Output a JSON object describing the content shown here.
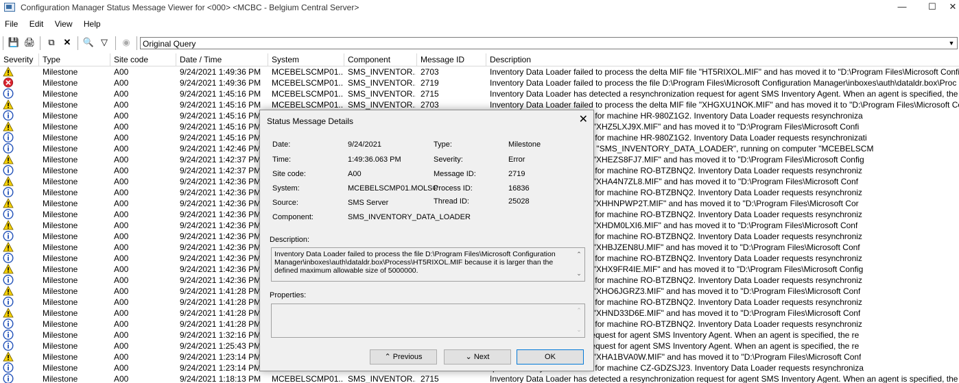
{
  "window": {
    "title": "Configuration Manager Status Message Viewer for <000> <MCBC - Belgium Central Server>"
  },
  "menu": [
    "File",
    "Edit",
    "View",
    "Help"
  ],
  "toolbar": {
    "query": "Original Query"
  },
  "columns": [
    "Severity",
    "Type",
    "Site code",
    "Date / Time",
    "System",
    "Component",
    "Message ID",
    "Description"
  ],
  "rows": [
    {
      "sev": "warning",
      "type": "Milestone",
      "site": "A00",
      "time": "9/24/2021 1:49:36 PM",
      "system": "MCEBELSCMP01...",
      "component": "SMS_INVENTOR...",
      "id": "2703",
      "desc": "Inventory Data Loader failed to process the delta MIF file \"HT5RIXOL.MIF\" and has moved it to \"D:\\Program Files\\Microsoft Configu"
    },
    {
      "sev": "error",
      "type": "Milestone",
      "site": "A00",
      "time": "9/24/2021 1:49:36 PM",
      "system": "MCEBELSCMP01...",
      "component": "SMS_INVENTOR...",
      "id": "2719",
      "desc": "Inventory Data Loader failed to process the file D:\\Program Files\\Microsoft Configuration Manager\\inboxes\\auth\\dataldr.box\\Proc"
    },
    {
      "sev": "info",
      "type": "Milestone",
      "site": "A00",
      "time": "9/24/2021 1:45:16 PM",
      "system": "MCEBELSCMP01...",
      "component": "SMS_INVENTOR...",
      "id": "2715",
      "desc": "Inventory Data Loader has detected a resynchronization request for agent SMS Inventory Agent. When an agent is specified, the re"
    },
    {
      "sev": "warning",
      "type": "Milestone",
      "site": "A00",
      "time": "9/24/2021 1:45:16 PM",
      "system": "MCEBELSCMP01...",
      "component": "SMS_INVENTOR...",
      "id": "2703",
      "desc": "Inventory Data Loader failed to process the delta MIF file \"XHGXU1NOK.MIF\" and has moved it to \"D:\\Program Files\\Microsoft Con"
    },
    {
      "sev": "info",
      "type": "Milestone",
      "site": "A00",
      "time": "9/24/2021 1:45:16 PM",
      "system": "",
      "component": "",
      "id": "",
      "desc": "quested a resynchronization for machine HR-980Z1G2. Inventory Data Loader requests resynchroniza"
    },
    {
      "sev": "warning",
      "type": "Milestone",
      "site": "A00",
      "time": "9/24/2021 1:45:16 PM",
      "system": "",
      "component": "",
      "id": "",
      "desc": "to process the delta MIF file \"XHZ5LXJ9X.MIF\" and has moved it to \"D:\\Program Files\\Microsoft Confi"
    },
    {
      "sev": "info",
      "type": "Milestone",
      "site": "A00",
      "time": "9/24/2021 1:45:16 PM",
      "system": "",
      "component": "",
      "id": "",
      "desc": "quested a resynchronization for machine HR-980Z1G2. Inventory Data Loader requests resynchronizati"
    },
    {
      "sev": "info",
      "type": "Milestone",
      "site": "A00",
      "time": "9/24/2021 1:42:46 PM",
      "system": "",
      "component": "",
      "id": "",
      "desc": "zer detected that component \"SMS_INVENTORY_DATA_LOADER\", running on computer \"MCEBELSCM"
    },
    {
      "sev": "warning",
      "type": "Milestone",
      "site": "A00",
      "time": "9/24/2021 1:42:37 PM",
      "system": "",
      "component": "",
      "id": "",
      "desc": "to process the delta MIF file \"XHEZS8FJ7.MIF\" and has moved it to \"D:\\Program Files\\Microsoft Config"
    },
    {
      "sev": "info",
      "type": "Milestone",
      "site": "A00",
      "time": "9/24/2021 1:42:37 PM",
      "system": "",
      "component": "",
      "id": "",
      "desc": "quested a resynchronization for machine RO-BTZBNQ2. Inventory Data Loader requests resynchroniz"
    },
    {
      "sev": "warning",
      "type": "Milestone",
      "site": "A00",
      "time": "9/24/2021 1:42:36 PM",
      "system": "",
      "component": "",
      "id": "",
      "desc": "to process the delta MIF file \"XHA4N7ZL8.MIF\" and has moved it to \"D:\\Program Files\\Microsoft Conf"
    },
    {
      "sev": "info",
      "type": "Milestone",
      "site": "A00",
      "time": "9/24/2021 1:42:36 PM",
      "system": "",
      "component": "",
      "id": "",
      "desc": "quested a resynchronization for machine RO-BTZBNQ2. Inventory Data Loader requests resynchroniz"
    },
    {
      "sev": "warning",
      "type": "Milestone",
      "site": "A00",
      "time": "9/24/2021 1:42:36 PM",
      "system": "",
      "component": "",
      "id": "",
      "desc": "to process the delta MIF file \"XHHNPWP2T.MIF\" and has moved it to \"D:\\Program Files\\Microsoft Cor"
    },
    {
      "sev": "info",
      "type": "Milestone",
      "site": "A00",
      "time": "9/24/2021 1:42:36 PM",
      "system": "",
      "component": "",
      "id": "",
      "desc": "quested a resynchronization for machine RO-BTZBNQ2. Inventory Data Loader requests resynchroniz"
    },
    {
      "sev": "warning",
      "type": "Milestone",
      "site": "A00",
      "time": "9/24/2021 1:42:36 PM",
      "system": "",
      "component": "",
      "id": "",
      "desc": "to process the delta MIF file \"XHDM0LXI6.MIF\" and has moved it to \"D:\\Program Files\\Microsoft Conf"
    },
    {
      "sev": "info",
      "type": "Milestone",
      "site": "A00",
      "time": "9/24/2021 1:42:36 PM",
      "system": "",
      "component": "",
      "id": "",
      "desc": "quested a resynchronization for machine RO-BTZBNQ2. Inventory Data Loader requests resynchroniz"
    },
    {
      "sev": "warning",
      "type": "Milestone",
      "site": "A00",
      "time": "9/24/2021 1:42:36 PM",
      "system": "",
      "component": "",
      "id": "",
      "desc": "to process the delta MIF file \"XHBJZEN8U.MIF\" and has moved it to \"D:\\Program Files\\Microsoft Conf"
    },
    {
      "sev": "info",
      "type": "Milestone",
      "site": "A00",
      "time": "9/24/2021 1:42:36 PM",
      "system": "",
      "component": "",
      "id": "",
      "desc": "quested a resynchronization for machine RO-BTZBNQ2. Inventory Data Loader requests resynchroniz"
    },
    {
      "sev": "warning",
      "type": "Milestone",
      "site": "A00",
      "time": "9/24/2021 1:42:36 PM",
      "system": "",
      "component": "",
      "id": "",
      "desc": "to process the delta MIF file \"XHX9FR4IE.MIF\" and has moved it to \"D:\\Program Files\\Microsoft Config"
    },
    {
      "sev": "info",
      "type": "Milestone",
      "site": "A00",
      "time": "9/24/2021 1:42:36 PM",
      "system": "",
      "component": "",
      "id": "",
      "desc": "quested a resynchronization for machine RO-BTZBNQ2. Inventory Data Loader requests resynchroniz"
    },
    {
      "sev": "warning",
      "type": "Milestone",
      "site": "A00",
      "time": "9/24/2021 1:41:28 PM",
      "system": "",
      "component": "",
      "id": "",
      "desc": "to process the delta MIF file \"XHO6JGRZ3.MIF\" and has moved it to \"D:\\Program Files\\Microsoft Conf"
    },
    {
      "sev": "info",
      "type": "Milestone",
      "site": "A00",
      "time": "9/24/2021 1:41:28 PM",
      "system": "",
      "component": "",
      "id": "",
      "desc": "quested a resynchronization for machine RO-BTZBNQ2. Inventory Data Loader requests resynchroniz"
    },
    {
      "sev": "warning",
      "type": "Milestone",
      "site": "A00",
      "time": "9/24/2021 1:41:28 PM",
      "system": "",
      "component": "",
      "id": "",
      "desc": "to process the delta MIF file \"XHND33D6E.MIF\" and has moved it to \"D:\\Program Files\\Microsoft Conf"
    },
    {
      "sev": "info",
      "type": "Milestone",
      "site": "A00",
      "time": "9/24/2021 1:41:28 PM",
      "system": "",
      "component": "",
      "id": "",
      "desc": "quested a resynchronization for machine RO-BTZBNQ2. Inventory Data Loader requests resynchroniz"
    },
    {
      "sev": "info",
      "type": "Milestone",
      "site": "A00",
      "time": "9/24/2021 1:32:16 PM",
      "system": "",
      "component": "",
      "id": "",
      "desc": "tected a resynchronization request for agent SMS Inventory Agent. When an agent is specified, the re"
    },
    {
      "sev": "info",
      "type": "Milestone",
      "site": "A00",
      "time": "9/24/2021 1:25:43 PM",
      "system": "",
      "component": "",
      "id": "",
      "desc": "tected a resynchronization request for agent SMS Inventory Agent. When an agent is specified, the re"
    },
    {
      "sev": "warning",
      "type": "Milestone",
      "site": "A00",
      "time": "9/24/2021 1:23:14 PM",
      "system": "",
      "component": "",
      "id": "",
      "desc": "to process the delta MIF file \"XHA1BVA0W.MIF\" and has moved it to \"D:\\Program Files\\Microsoft Conf"
    },
    {
      "sev": "info",
      "type": "Milestone",
      "site": "A00",
      "time": "9/24/2021 1:23:14 PM",
      "system": "",
      "component": "",
      "id": "",
      "desc": "quested a resynchronization for machine CZ-GDZSJ23. Inventory Data Loader requests resynchroniza"
    },
    {
      "sev": "info",
      "type": "Milestone",
      "site": "A00",
      "time": "9/24/2021 1:18:13 PM",
      "system": "MCEBELSCMP01...",
      "component": "SMS_INVENTOR...",
      "id": "2715",
      "desc": "Inventory Data Loader has detected a resynchronization request for agent SMS Inventory Agent. When an agent is specified, the re"
    }
  ],
  "dialog": {
    "title": "Status Message Details",
    "date_label": "Date:",
    "date": "9/24/2021",
    "time_label": "Time:",
    "time": "1:49:36.063 PM",
    "site_label": "Site code:",
    "site": "A00",
    "system_label": "System:",
    "system": "MCEBELSCMP01.MOLSC",
    "source_label": "Source:",
    "source": "SMS Server",
    "component_label": "Component:",
    "component": "SMS_INVENTORY_DATA_LOADER",
    "type_label": "Type:",
    "type": "Milestone",
    "severity_label": "Severity:",
    "severity": "Error",
    "msgid_label": "Message ID:",
    "msgid": "2719",
    "pid_label": "Process ID:",
    "pid": "16836",
    "tid_label": "Thread ID:",
    "tid": "25028",
    "description_label": "Description:",
    "description": "Inventory Data Loader failed to process the file D:\\Program Files\\Microsoft Configuration Manager\\inboxes\\auth\\dataldr.box\\Process\\HT5RIXOL.MIF because it is larger than the defined maximum allowable size of 5000000.",
    "properties_label": "Properties:",
    "previous": "Previous",
    "next": "Next",
    "ok": "OK"
  },
  "colors": {
    "warning": "#f5d000",
    "error": "#d9232e",
    "info": "#1e4fb8"
  }
}
